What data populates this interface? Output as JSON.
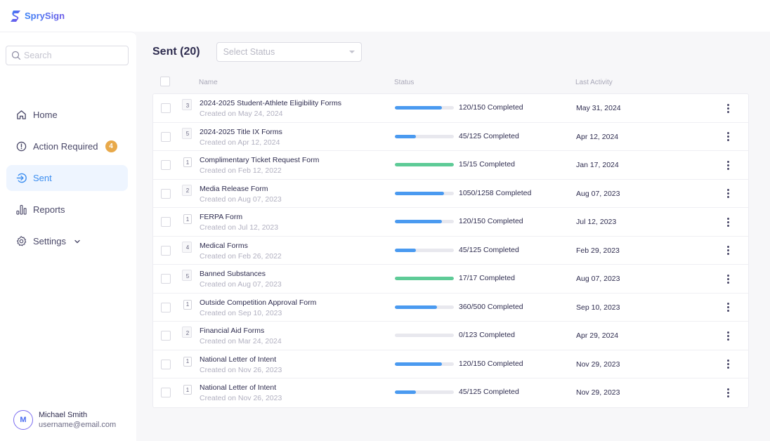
{
  "app": {
    "name": "SprySign",
    "brand_colors": {
      "primary": "#3b82f6",
      "secondary": "#6d5ce8"
    }
  },
  "sidebar": {
    "search_placeholder": "Search",
    "items": [
      {
        "label": "Home",
        "icon": "home-icon",
        "active": false
      },
      {
        "label": "Action Required",
        "icon": "alert-circle-icon",
        "active": false,
        "badge": "4"
      },
      {
        "label": "Sent",
        "icon": "sent-arrow-icon",
        "active": true
      },
      {
        "label": "Reports",
        "icon": "bar-chart-icon",
        "active": false
      },
      {
        "label": "Settings",
        "icon": "gear-icon",
        "active": false,
        "expandable": true
      }
    ],
    "user": {
      "initial": "M",
      "name": "Michael Smith",
      "email": "username@email.com"
    }
  },
  "main": {
    "title": "Sent (20)",
    "status_filter": {
      "placeholder": "Select Status",
      "value": ""
    },
    "columns": {
      "name": "Name",
      "status": "Status",
      "last_activity": "Last Activity"
    },
    "rows": [
      {
        "docs": "3",
        "name": "2024-2025 Student-Athlete Eligibility Forms",
        "created": "Created on May 24, 2024",
        "completed": 120,
        "total": 150,
        "status": "120/150 Completed",
        "last_activity": "May 31, 2024"
      },
      {
        "docs": "5",
        "name": "2024-2025 Title IX Forms",
        "created": "Created on Apr 12, 2024",
        "completed": 45,
        "total": 125,
        "status": "45/125 Completed",
        "last_activity": "Apr 12, 2024"
      },
      {
        "docs": "1",
        "name": "Complimentary Ticket Request Form",
        "created": "Created on Feb 12, 2022",
        "completed": 15,
        "total": 15,
        "status": "15/15 Completed",
        "last_activity": "Jan 17, 2024"
      },
      {
        "docs": "2",
        "name": "Media Release Form",
        "created": "Created on Aug 07, 2023",
        "completed": 1050,
        "total": 1258,
        "status": "1050/1258 Completed",
        "last_activity": "Aug 07, 2023"
      },
      {
        "docs": "1",
        "name": "FERPA Form",
        "created": "Created on Jul 12, 2023",
        "completed": 120,
        "total": 150,
        "status": "120/150 Completed",
        "last_activity": "Jul 12, 2023"
      },
      {
        "docs": "4",
        "name": "Medical Forms",
        "created": "Created on Feb 26, 2022",
        "completed": 45,
        "total": 125,
        "status": "45/125 Completed",
        "last_activity": "Feb 29, 2023"
      },
      {
        "docs": "5",
        "name": "Banned Substances",
        "created": "Created on Aug 07, 2023",
        "completed": 17,
        "total": 17,
        "status": "17/17 Completed",
        "last_activity": "Aug 07, 2023"
      },
      {
        "docs": "1",
        "name": "Outside Competition Approval Form",
        "created": "Created on Sep 10, 2023",
        "completed": 360,
        "total": 500,
        "status": "360/500 Completed",
        "last_activity": "Sep 10, 2023"
      },
      {
        "docs": "2",
        "name": "Financial Aid Forms",
        "created": "Created on Mar 24, 2024",
        "completed": 0,
        "total": 123,
        "status": "0/123 Completed",
        "last_activity": "Apr 29, 2024"
      },
      {
        "docs": "1",
        "name": "National Letter of Intent",
        "created": "Created on Nov 26, 2023",
        "completed": 120,
        "total": 150,
        "status": "120/150 Completed",
        "last_activity": "Nov 29, 2023"
      },
      {
        "docs": "1",
        "name": "National Letter of Intent",
        "created": "Created on Nov 26, 2023",
        "completed": 45,
        "total": 125,
        "status": "45/125 Completed",
        "last_activity": "Nov 29, 2023"
      }
    ],
    "progress_colors": {
      "in_progress": "#4a9af0",
      "complete": "#5ecb97",
      "track": "#e8e8ee"
    }
  }
}
